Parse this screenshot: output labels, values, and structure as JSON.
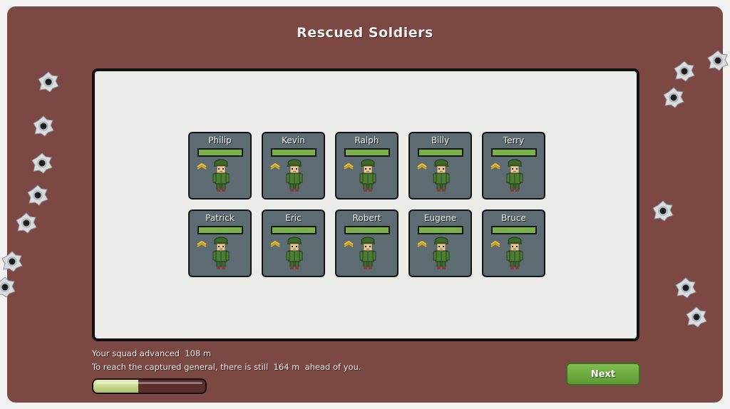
{
  "screen": {
    "title": "Rescued Soldiers"
  },
  "soldiers": [
    {
      "name": "Philip"
    },
    {
      "name": "Kevin"
    },
    {
      "name": "Ralph"
    },
    {
      "name": "Billy"
    },
    {
      "name": "Terry"
    },
    {
      "name": "Patrick"
    },
    {
      "name": "Eric"
    },
    {
      "name": "Robert"
    },
    {
      "name": "Eugene"
    },
    {
      "name": "Bruce"
    }
  ],
  "status": {
    "line1": "Your squad advanced  108 m",
    "line2": "To reach the captured general, there is still  164 m  ahead of you.",
    "progress_fraction": 0.4
  },
  "buttons": {
    "next_label": "Next"
  },
  "colors": {
    "background": "#7b4843",
    "card": "#5c6c72",
    "health": "#7bb04a",
    "button": "#6aab3f"
  },
  "icons": {
    "decoration": "bullet-hole-icon",
    "rank": "corporal-chevron-icon",
    "soldier": "soldier-sprite-icon"
  }
}
